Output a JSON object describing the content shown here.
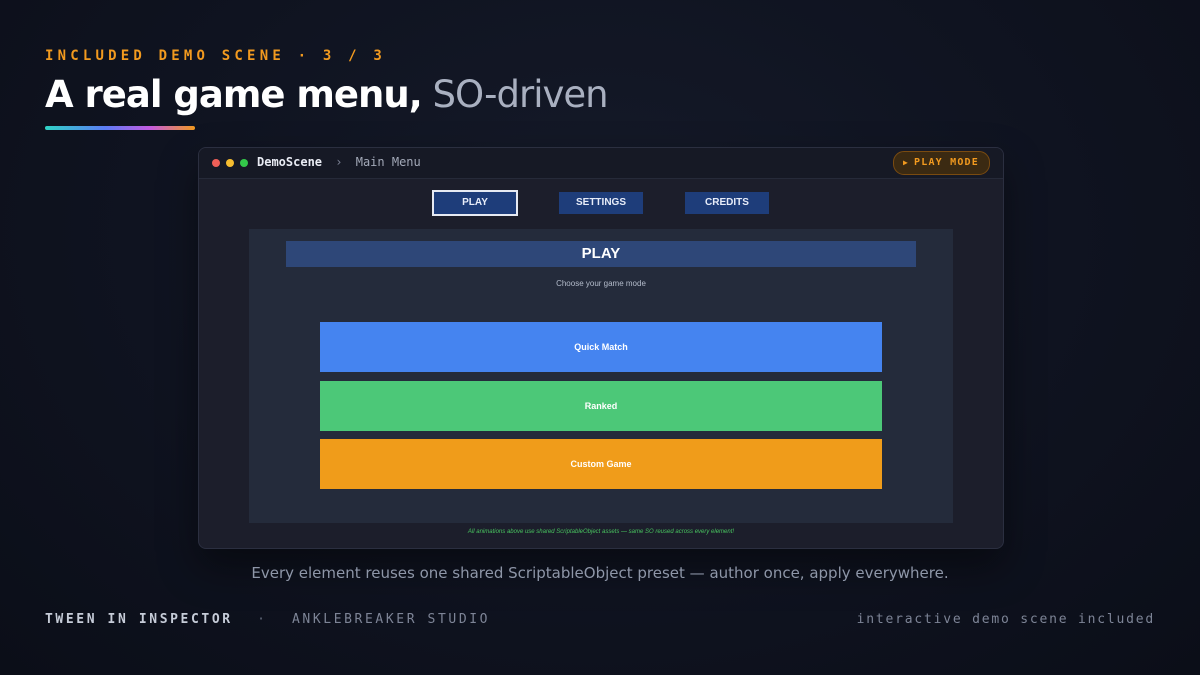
{
  "slide": {
    "eyebrow": "INCLUDED DEMO SCENE · 3 / 3",
    "headline_strong": "A real game menu,",
    "headline_light": "SO-driven",
    "accent_gradient": [
      "#2fd3c5",
      "#5b7cf5",
      "#c45be0",
      "#f29a1f"
    ]
  },
  "window": {
    "scene_name": "DemoScene",
    "breadcrumb_separator": "›",
    "page_name": "Main Menu",
    "play_mode_label": "PLAY MODE",
    "play_mode_icon": "play-triangle-icon",
    "play_mode_color": "#f29a1f",
    "traffic_lights": [
      "#ef5f58",
      "#f6bd30",
      "#33c84a"
    ]
  },
  "menu": {
    "tabs": [
      {
        "label": "PLAY",
        "active": true
      },
      {
        "label": "SETTINGS",
        "active": false
      },
      {
        "label": "CREDITS",
        "active": false
      }
    ],
    "panel_title": "PLAY",
    "panel_subtitle": "Choose your game mode",
    "modes": [
      {
        "label": "Quick Match",
        "color": "#4584f0"
      },
      {
        "label": "Ranked",
        "color": "#4cc878"
      },
      {
        "label": "Custom Game",
        "color": "#f09c1a"
      }
    ],
    "footnote": "All animations above use shared ScriptableObject assets — same SO reused across every element!"
  },
  "caption": "Every element reuses one shared ScriptableObject preset — author once, apply everywhere.",
  "footer": {
    "product": "TWEEN IN INSPECTOR",
    "separator": "·",
    "studio": "ANKLEBREAKER STUDIO",
    "tagline": "interactive demo scene included"
  }
}
